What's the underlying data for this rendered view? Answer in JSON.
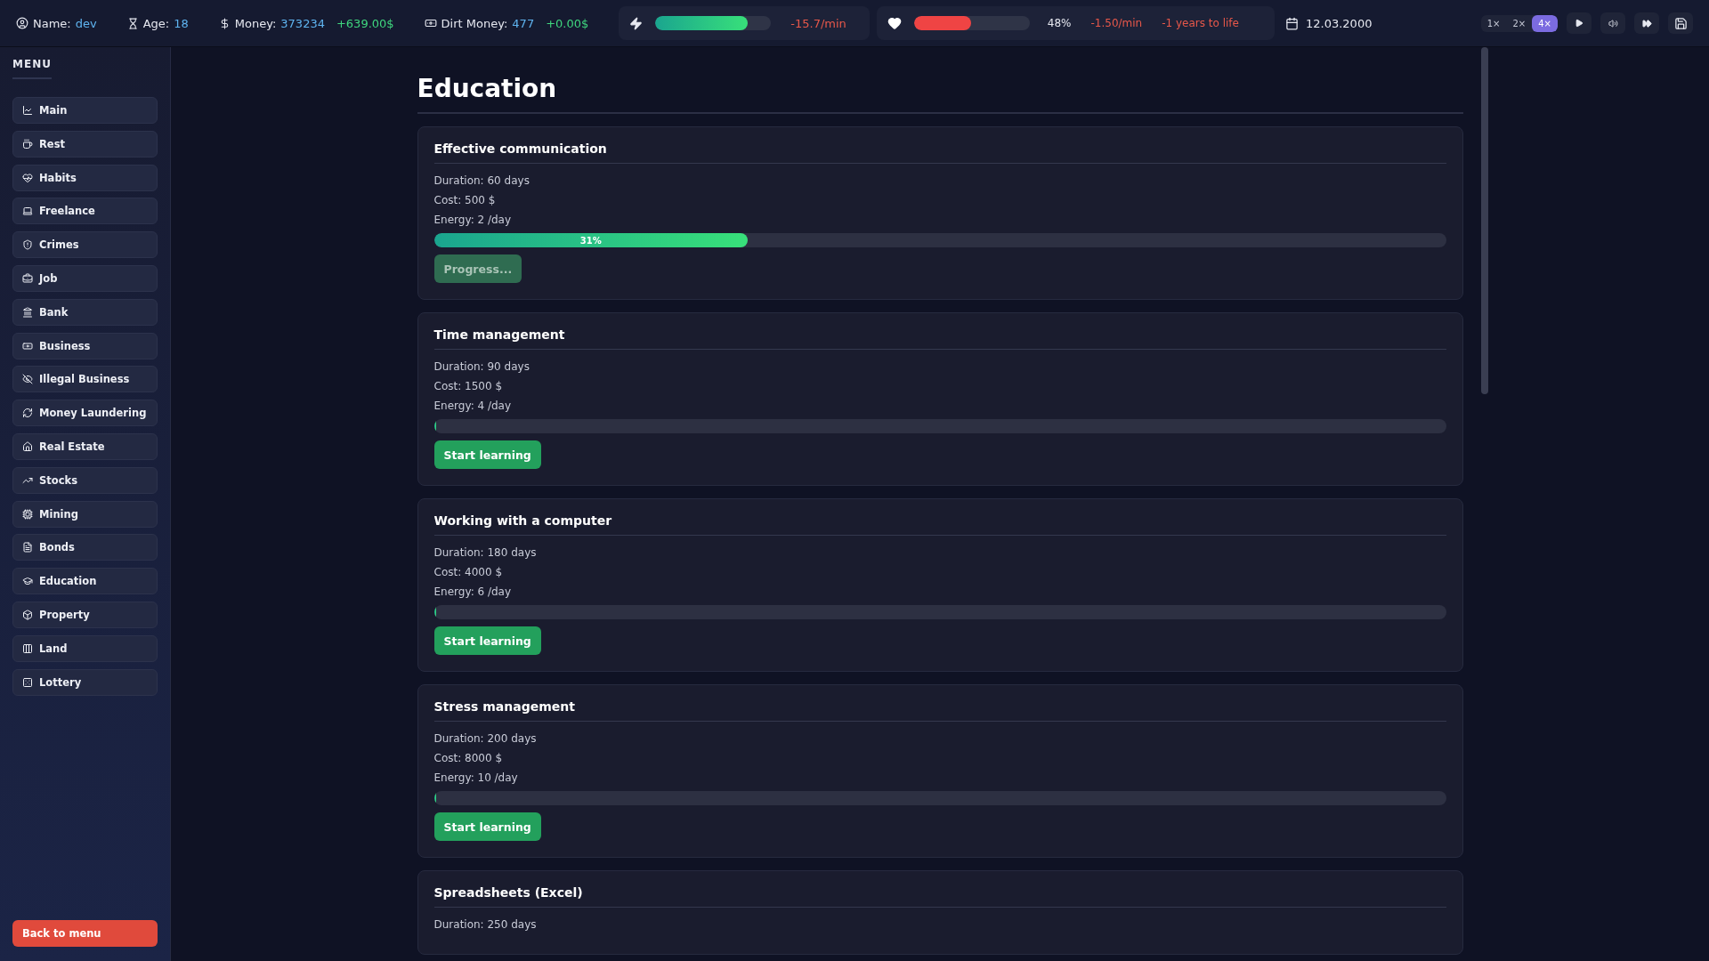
{
  "top_bar": {
    "name_label": "Name:",
    "name": "dev",
    "age_label": "Age:",
    "age": "18",
    "money_label": "Money:",
    "money": "373234",
    "money_delta": "+639.00$",
    "dirt_label": "Dirt Money:",
    "dirt_money": "477",
    "dirt_delta": "+0.00$",
    "energy": {
      "level": 0.8,
      "rate": "-15.7/min"
    },
    "health": {
      "level": 0.49,
      "percent": "48%",
      "rate": "-1.50/min",
      "life": "-1 years to life"
    },
    "date": "12.03.2000",
    "speeds": [
      {
        "label": "1×",
        "selected": false
      },
      {
        "label": "2×",
        "selected": false
      },
      {
        "label": "4×",
        "selected": true
      }
    ]
  },
  "sidebar": {
    "title": "MENU",
    "items": [
      {
        "label": "Main"
      },
      {
        "label": "Rest"
      },
      {
        "label": "Habits"
      },
      {
        "label": "Freelance"
      },
      {
        "label": "Crimes"
      },
      {
        "label": "Job"
      },
      {
        "label": "Bank"
      },
      {
        "label": "Business"
      },
      {
        "label": "Illegal Business"
      },
      {
        "label": "Money Laundering"
      },
      {
        "label": "Real Estate"
      },
      {
        "label": "Stocks"
      },
      {
        "label": "Mining"
      },
      {
        "label": "Bonds"
      },
      {
        "label": "Education"
      },
      {
        "label": "Property"
      },
      {
        "label": "Land"
      },
      {
        "label": "Lottery"
      }
    ],
    "back_button": "Back to menu"
  },
  "page_title": "Education",
  "courses": [
    {
      "title": "Effective communication",
      "duration": "Duration: 60 days",
      "cost": "Cost: 500 $",
      "energy": "Energy: 2 /day",
      "level": 0.31,
      "progress_label": "31%",
      "button": "Progress...",
      "disabled": true
    },
    {
      "title": "Time management",
      "duration": "Duration: 90 days",
      "cost": "Cost: 1500 $",
      "energy": "Energy: 4 /day",
      "level": 0,
      "button": "Start learning",
      "disabled": false
    },
    {
      "title": "Working with a computer",
      "duration": "Duration: 180 days",
      "cost": "Cost: 4000 $",
      "energy": "Energy: 6 /day",
      "level": 0,
      "button": "Start learning",
      "disabled": false
    },
    {
      "title": "Stress management",
      "duration": "Duration: 200 days",
      "cost": "Cost: 8000 $",
      "energy": "Energy: 10 /day",
      "level": 0,
      "button": "Start learning",
      "disabled": false
    },
    {
      "title": "Spreadsheets (Excel)",
      "duration": "Duration: 250 days"
    }
  ]
}
